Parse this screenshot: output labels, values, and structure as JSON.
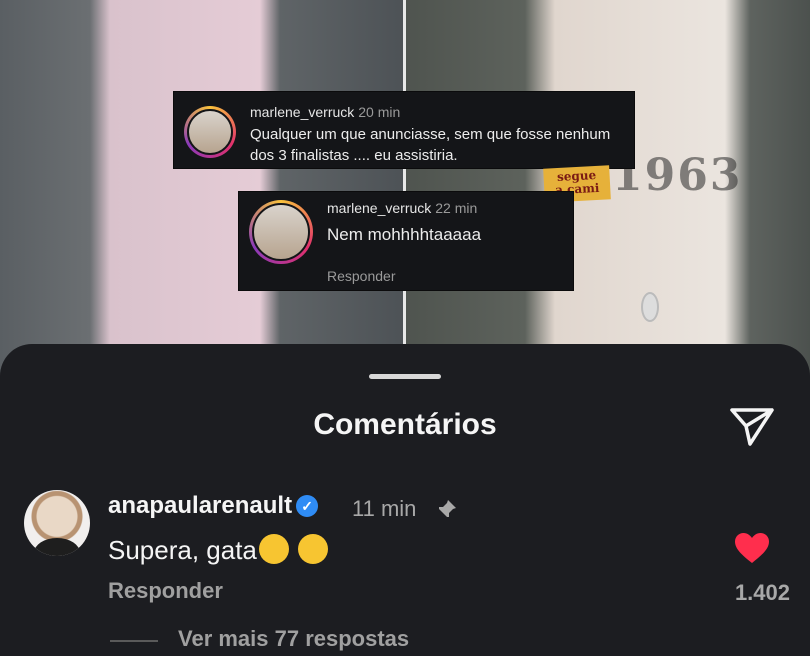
{
  "background": {
    "sticker_text": "segue\na cami",
    "tattoo_text": "1963"
  },
  "quoted_comments": [
    {
      "username": "marlene_verruck",
      "time": "20 min",
      "text": "Qualquer um que anunciasse, sem que fosse nenhum dos 3 finalistas .... eu assistiria."
    },
    {
      "username": "marlene_verruck",
      "time": "22 min",
      "text": "Nem mohhhhtaaaaa",
      "reply_label": "Responder"
    }
  ],
  "sheet": {
    "title": "Comentários",
    "send_icon": "send-icon"
  },
  "comment": {
    "username": "anapaularenault",
    "verified": true,
    "time": "11 min",
    "pinned": true,
    "text": "Supera, gata",
    "emojis": [
      "hand-over-mouth-emoji",
      "sweat-smile-emoji"
    ],
    "reply_label": "Responder",
    "likes": "1.402",
    "liked": true,
    "more_replies": "Ver mais 77 respostas"
  },
  "colors": {
    "sheet_bg": "#1c1d21",
    "heart": "#ff2e4d",
    "verified": "#2f8cf5"
  }
}
